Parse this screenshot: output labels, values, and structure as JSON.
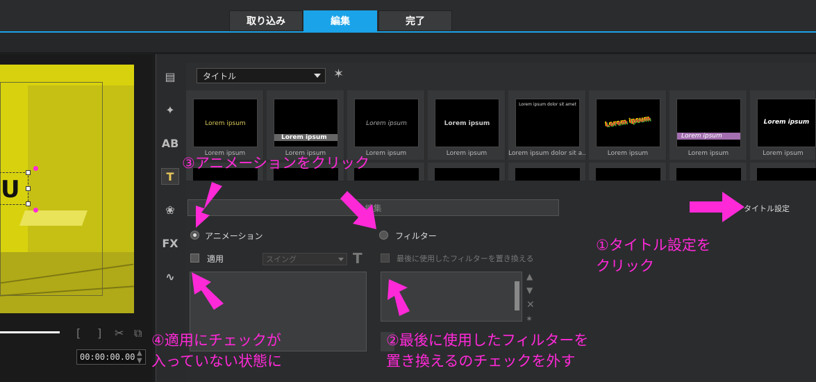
{
  "tabs": [
    {
      "label": "取り込み"
    },
    {
      "label": "編集"
    },
    {
      "label": "完了"
    }
  ],
  "preview": {
    "overlay_text": "U",
    "timecode": "00:00:00.00"
  },
  "library": {
    "dropdown_value": "タイトル",
    "thumbnails": [
      {
        "caption": "Lorem ipsum",
        "preview": "Lorem ipsum"
      },
      {
        "caption": "Lorem ipsum",
        "preview": "Lorem ipsum"
      },
      {
        "caption": "Lorem ipsum",
        "preview": "Lorem ipsum"
      },
      {
        "caption": "Lorem ipsum",
        "preview": "Lorem ipsum"
      },
      {
        "caption": "Lorem ipsum dolor sit a...",
        "preview": "Lorem ipsum dolor sit amet"
      },
      {
        "caption": "Lorem ipsum",
        "preview": "Lorem ipsum"
      },
      {
        "caption": "Lorem ipsum",
        "preview": "Lorem ipsum"
      },
      {
        "caption": "Lorem ipsum",
        "preview": "Lorem ipsum"
      }
    ]
  },
  "settings": {
    "edit_tab": "編集",
    "title_settings": "タイトル設定",
    "animation_label": "アニメーション",
    "filter_label": "フィルター",
    "apply_label": "適用",
    "animation_select": "スイング",
    "replace_filter_label": "最後に使用したフィルターを置き換える"
  },
  "annotations": {
    "a1_line1": "①タイトル設定を",
    "a1_line2": "クリック",
    "a2_line1": "②最後に使用したフィルターを",
    "a2_line2": "置き換えるのチェックを外す",
    "a3": "③アニメーションをクリック",
    "a4_line1": "④適用にチェックが",
    "a4_line2": "入っていない状態に"
  },
  "colors": {
    "accent": "#1aa3e8",
    "annotation": "#ff29d8",
    "video_tint": "#d8d20e"
  }
}
